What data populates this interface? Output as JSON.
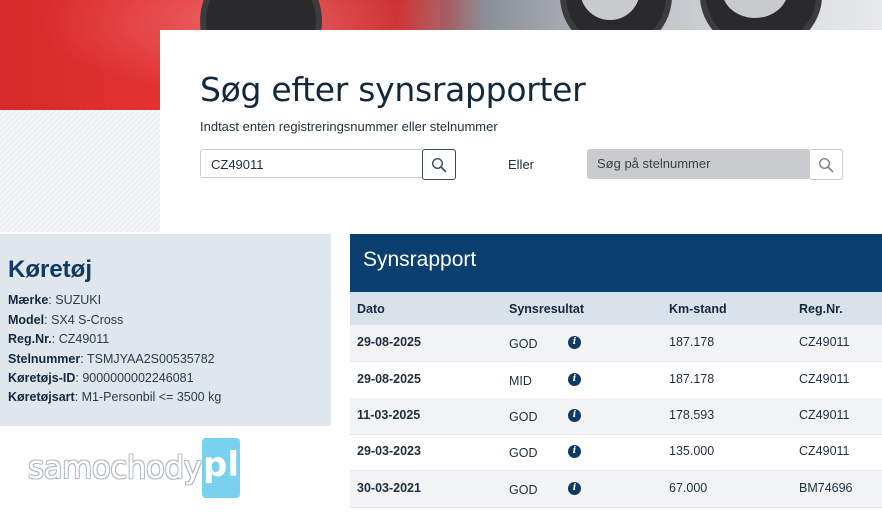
{
  "search": {
    "title": "Søg efter synsrapporter",
    "subtitle": "Indtast enten registreringsnummer eller stelnummer",
    "reg_value": "CZ49011",
    "or_label": "Eller",
    "vin_placeholder": "Søg på stelnummer"
  },
  "vehicle": {
    "title": "Køretøj",
    "fields": [
      {
        "label": "Mærke",
        "value": "SUZUKI"
      },
      {
        "label": "Model",
        "value": "SX4 S-Cross"
      },
      {
        "label": "Reg.Nr.",
        "value": "CZ49011"
      },
      {
        "label": "Stelnummer",
        "value": "TSMJYAA2S00535782"
      },
      {
        "label": "Køretøjs-ID",
        "value": "9000000002246081"
      },
      {
        "label": "Køretøjsart",
        "value": "M1-Personbil <= 3500 kg"
      }
    ]
  },
  "report": {
    "title": "Synsrapport",
    "columns": [
      "Dato",
      "Synsresultat",
      "Km-stand",
      "Reg.Nr."
    ],
    "rows": [
      {
        "date": "29-08-2025",
        "result": "GOD",
        "km": "187.178",
        "reg": "CZ49011"
      },
      {
        "date": "29-08-2025",
        "result": "MID",
        "km": "187.178",
        "reg": "CZ49011"
      },
      {
        "date": "11-03-2025",
        "result": "GOD",
        "km": "178.593",
        "reg": "CZ49011"
      },
      {
        "date": "29-03-2023",
        "result": "GOD",
        "km": "135.000",
        "reg": "CZ49011"
      },
      {
        "date": "30-03-2021",
        "result": "GOD",
        "km": "67.000",
        "reg": "BM74696"
      }
    ],
    "info_icon": "i"
  },
  "watermark": {
    "text": "samochody",
    "box": "pl"
  },
  "icons": {
    "search": "search-icon",
    "info": "info-icon"
  },
  "colors": {
    "primary": "#0a3f70",
    "panel": "#dfe6ec",
    "watermark_box": "#78d1ef"
  }
}
